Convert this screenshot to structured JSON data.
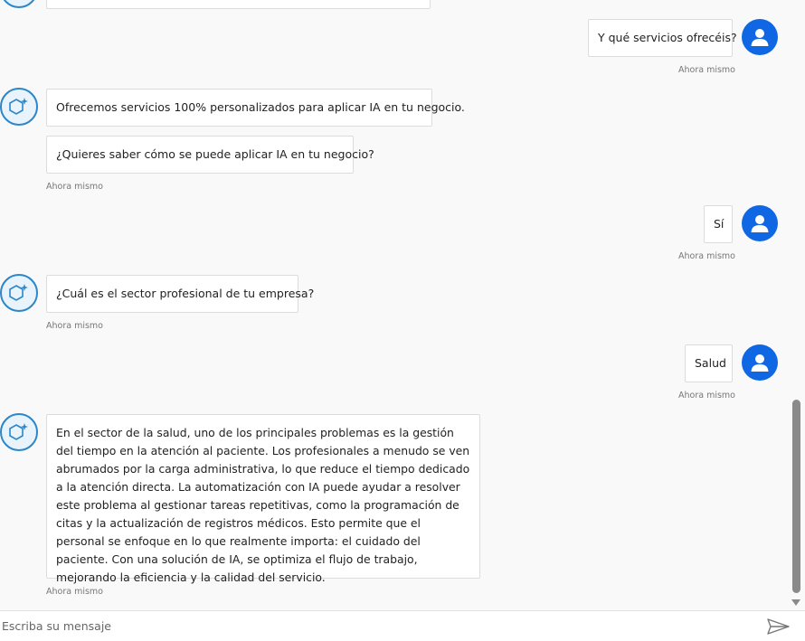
{
  "chat": {
    "messages": [
      {
        "sender": "user",
        "text": "Y qué servicios ofrecéis?",
        "time": "Ahora mismo"
      },
      {
        "sender": "bot",
        "text": "Ofrecemos servicios 100% personalizados para aplicar IA en tu negocio."
      },
      {
        "sender": "bot",
        "text": "¿Quieres saber cómo se puede aplicar IA en tu negocio?",
        "time": "Ahora mismo"
      },
      {
        "sender": "user",
        "text": "Sí",
        "time": "Ahora mismo"
      },
      {
        "sender": "bot",
        "text": "¿Cuál es el sector profesional de tu empresa?",
        "time": "Ahora mismo"
      },
      {
        "sender": "user",
        "text": "Salud",
        "time": "Ahora mismo"
      },
      {
        "sender": "bot",
        "text": "En el sector de la salud, uno de los principales problemas es la gestión del tiempo en la atención al paciente. Los profesionales a menudo se ven abrumados por la carga administrativa, lo que reduce el tiempo dedicado a la atención directa. La automatización con IA puede ayudar a resolver este problema al gestionar tareas repetitivas, como la programación de citas y la actualización de registros médicos. Esto permite que el personal se enfoque en lo que realmente importa: el cuidado del paciente. Con una solución de IA, se optimiza el flujo de trabajo, mejorando la eficiencia y la calidad del servicio.",
        "time": "Ahora mismo"
      }
    ]
  },
  "composer": {
    "placeholder": "Escriba su mensaje"
  },
  "icons": {
    "bot_avatar": "hexagon-sparkle-icon",
    "user_avatar": "person-icon",
    "send": "paper-plane-icon"
  },
  "colors": {
    "user_avatar": "#0f67e4",
    "bot_avatar_border": "#2c86c8"
  }
}
